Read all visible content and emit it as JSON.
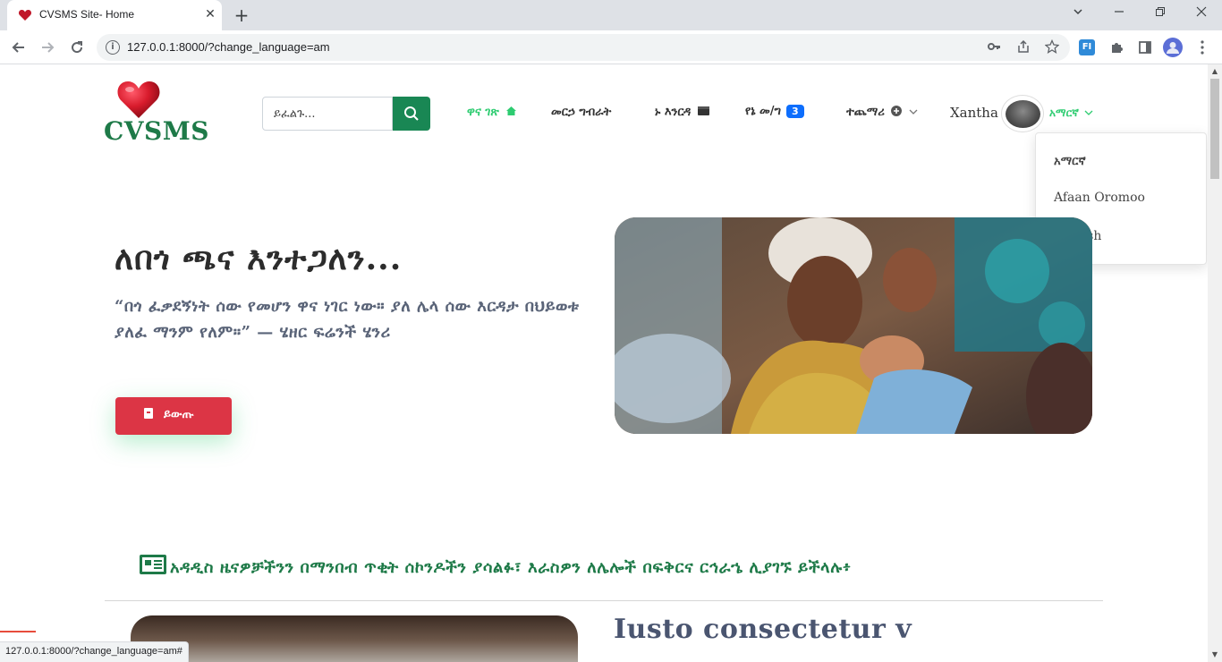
{
  "browser": {
    "tab_title": "CVSMS Site- Home",
    "url": "127.0.0.1:8000/?change_language=am",
    "status_url": "127.0.0.1:8000/?change_language=am#",
    "new_tab_symbol": "+",
    "close_symbol": "✕",
    "icons": [
      "back-icon",
      "forward-icon",
      "reload-icon",
      "key-icon",
      "share-icon",
      "star-icon",
      "extension-icon",
      "puzzle-icon",
      "sidepanel-icon",
      "profile-icon",
      "menu-icon"
    ]
  },
  "site": {
    "logo_text": "CVSMS",
    "search_placeholder": "ይፈልጉ...",
    "nav": {
      "home": "ዋና ገጽ",
      "services": "መርኃ ግብራት",
      "help": "ኑ እንርዳ",
      "messages": "የኔ መ/ግ",
      "messages_count": "3",
      "add": "ተጨማሪ"
    },
    "username": "Xantha",
    "language_current": "አማርኛ",
    "language_options": [
      "አማርኛ",
      "Afaan Oromoo",
      "English"
    ]
  },
  "hero": {
    "title": "ለበጎ ጫና እንተጋለን...",
    "quote": "“በጎ ፈቃደኝነት ሰው የመሆን ዋና ነገር ነው። ያለ ሌላ ሰው እርዳታ በህይወቱ ያለፈ ማንም የለም።” — ሄዘር ፍሬንች ሄንሪ",
    "exit_label": "ይውጡ"
  },
  "news": {
    "headline": "አዳዲስ ዜናዎቻችንን በማንበብ ጥቂት ሰኮንዶችን ያሳልፉ፣ እራስዎን ለሌሎች በፍቅርና ርኅራኄ ሊያገኙ ይችላሉ፥",
    "first_card_title": "Iusto consectetur v"
  },
  "colors": {
    "brand_green": "#1e7a48",
    "search_green": "#198754",
    "active_nav": "#2ecc71",
    "badge_blue": "#0d6efd",
    "exit_red": "#dc3545"
  }
}
